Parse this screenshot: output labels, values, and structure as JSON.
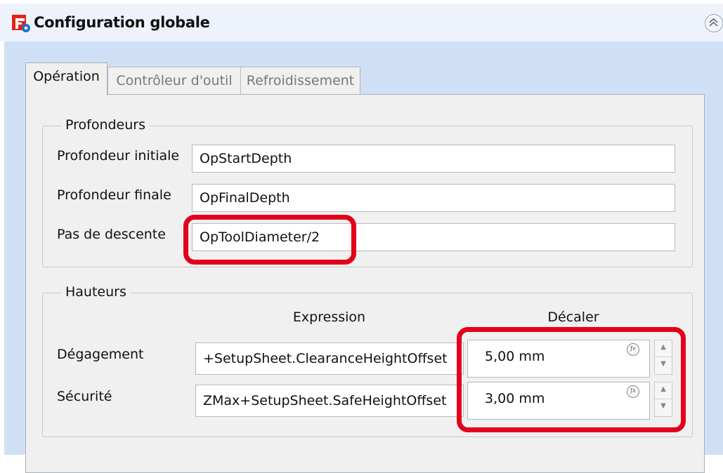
{
  "panel": {
    "title": "Configuration globale",
    "collapse_glyph": "⌃"
  },
  "tabs": [
    {
      "label": "Opération",
      "active": true
    },
    {
      "label": "Contrôleur d'outil",
      "active": false
    },
    {
      "label": "Refroidissement",
      "active": false
    }
  ],
  "depths": {
    "legend": "Profondeurs",
    "rows": [
      {
        "label": "Profondeur initiale",
        "value": "OpStartDepth"
      },
      {
        "label": "Profondeur finale",
        "value": "OpFinalDepth"
      },
      {
        "label": "Pas de descente",
        "value": "OpToolDiameter/2"
      }
    ]
  },
  "heights": {
    "legend": "Hauteurs",
    "col_expression": "Expression",
    "col_offset": "Décaler",
    "rows": [
      {
        "label": "Dégagement",
        "expression": "+SetupSheet.ClearanceHeightOffset",
        "offset": "5,00 mm"
      },
      {
        "label": "Sécurité",
        "expression": "ZMax+SetupSheet.SafeHeightOffset",
        "offset": "3,00 mm"
      }
    ]
  },
  "icons": {
    "logo": "freecad-logo-icon",
    "unit": "f(x)-icon",
    "unit_text": "ƒx",
    "spin_up": "▲",
    "spin_down": "▼"
  },
  "colors": {
    "highlight": "#e2001a",
    "header_band": "#eef3fb",
    "body_background": "#cfe0f6"
  }
}
